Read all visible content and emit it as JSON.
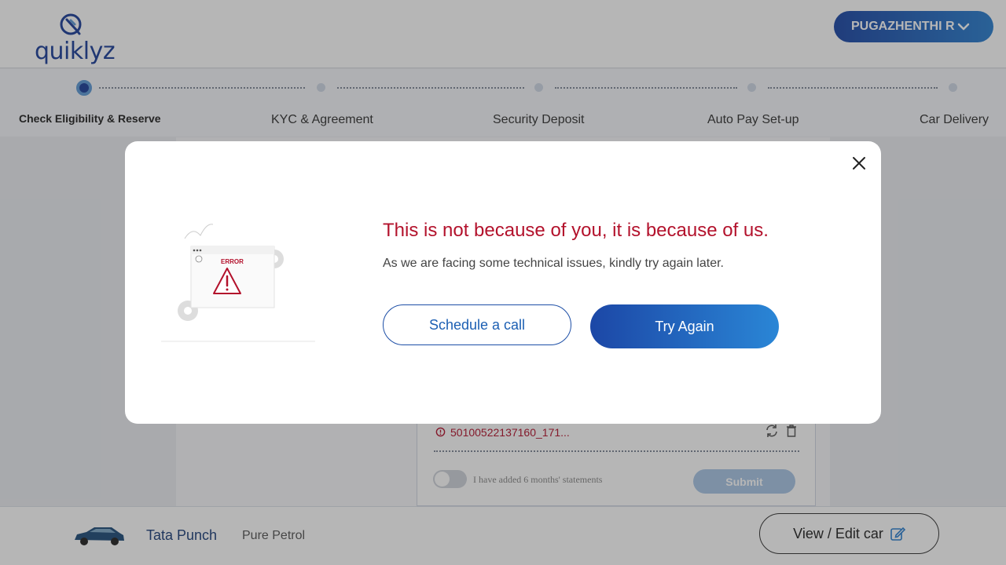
{
  "header": {
    "logo_text": "quiklyz",
    "user_name": "PUGAZHENTHI R"
  },
  "stepper": {
    "steps": [
      {
        "label": "Check Eligibility & Reserve",
        "active": true
      },
      {
        "label": "KYC & Agreement",
        "active": false
      },
      {
        "label": "Security Deposit",
        "active": false
      },
      {
        "label": "Auto Pay Set-up",
        "active": false
      },
      {
        "label": "Car Delivery",
        "active": false
      }
    ]
  },
  "background": {
    "file_name": "50100522137160_171...",
    "toggle_text": "I have added 6 months' statements",
    "submit_label": "Submit"
  },
  "footer": {
    "car_name": "Tata Punch",
    "car_variant": "Pure Petrol",
    "edit_label": "View / Edit car"
  },
  "modal": {
    "illustration_text": "ERROR",
    "title": "This is not because of you, it is because of us.",
    "subtitle": "As we are facing some technical issues, kindly try again later.",
    "schedule_label": "Schedule a call",
    "try_again_label": "Try Again"
  },
  "colors": {
    "brand": "#1c3f9a",
    "accent_gradient_start": "#1c47a6",
    "accent_gradient_end": "#2a86d6",
    "error": "#b3122c"
  }
}
